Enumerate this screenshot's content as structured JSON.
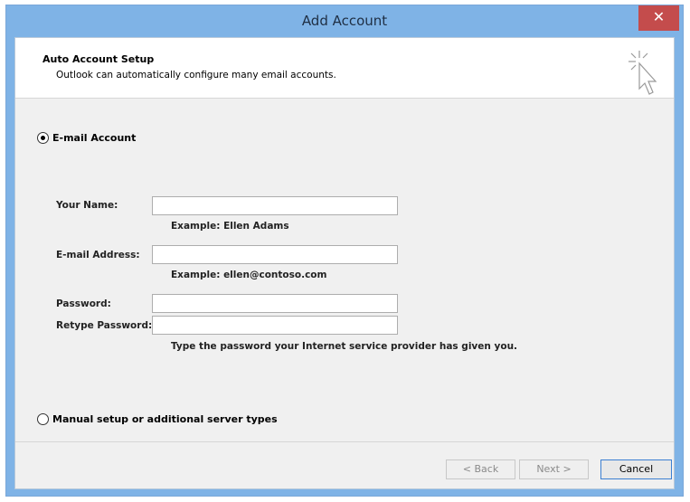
{
  "window": {
    "title": "Add Account",
    "close_glyph": "✕"
  },
  "header": {
    "title": "Auto Account Setup",
    "description": "Outlook can automatically configure many email accounts.",
    "icon": "cursor-sparkle-icon"
  },
  "options": {
    "email_account": {
      "label": "E-mail Account",
      "selected": true
    },
    "manual_setup": {
      "label": "Manual setup or additional server types",
      "selected": false
    }
  },
  "form": {
    "your_name": {
      "label": "Your Name:",
      "value": "",
      "example": "Example: Ellen Adams"
    },
    "email_address": {
      "label": "E-mail Address:",
      "value": "",
      "example": "Example: ellen@contoso.com"
    },
    "password": {
      "label": "Password:",
      "value": ""
    },
    "retype_password": {
      "label": "Retype Password:",
      "value": ""
    },
    "password_hint": "Type the password your Internet service provider has given you."
  },
  "buttons": {
    "back": "< Back",
    "next": "Next >",
    "cancel": "Cancel"
  }
}
